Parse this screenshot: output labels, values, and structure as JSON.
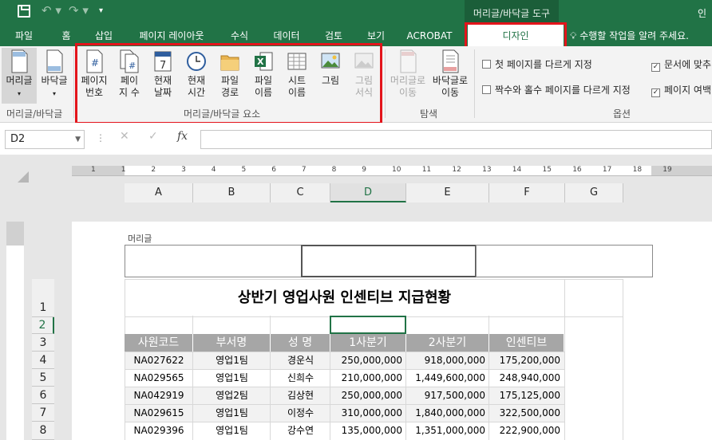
{
  "title_bar": {
    "context_group": "머리글/바닥글 도구",
    "user": "인"
  },
  "tabs": [
    "파일",
    "홈",
    "삽입",
    "페이지 레이아웃",
    "수식",
    "데이터",
    "검토",
    "보기",
    "ACROBAT",
    "디자인"
  ],
  "tell_me": "수행할 작업을 알려 주세요.",
  "ribbon": {
    "hf_group": {
      "label": "머리글/바닥글",
      "header": "머리글",
      "footer": "바닥글"
    },
    "elements_group": {
      "label": "머리글/바닥글 요소",
      "buttons": [
        {
          "l1": "페이지",
          "l2": "번호"
        },
        {
          "l1": "페이",
          "l2": "지 수"
        },
        {
          "l1": "현재",
          "l2": "날짜"
        },
        {
          "l1": "현재",
          "l2": "시간"
        },
        {
          "l1": "파일",
          "l2": "경로"
        },
        {
          "l1": "파일",
          "l2": "이름"
        },
        {
          "l1": "시트",
          "l2": "이름"
        },
        {
          "l1": "그림",
          "l2": ""
        },
        {
          "l1": "그림",
          "l2": "서식"
        }
      ]
    },
    "nav_group": {
      "label": "탐색",
      "to_header": {
        "l1": "머리글로",
        "l2": "이동"
      },
      "to_footer": {
        "l1": "바닥글로",
        "l2": "이동"
      }
    },
    "options_group": {
      "label": "옵션",
      "opt1": "첫 페이지를 다르게 지정",
      "opt2": "짝수와 홀수 페이지를 다르게 지정",
      "opt3": "문서에 맞추",
      "opt4": "페이지 여백"
    }
  },
  "formula_bar": {
    "name_box": "D2",
    "fx": "fx",
    "cancel": "✕",
    "enter": "✓",
    "value": ""
  },
  "ruler_numbers": [
    "1",
    "1",
    "2",
    "3",
    "4",
    "5",
    "6",
    "7",
    "8",
    "9",
    "10",
    "11",
    "12",
    "13",
    "14",
    "15",
    "16",
    "17",
    "18",
    "19"
  ],
  "columns": [
    "A",
    "B",
    "C",
    "D",
    "E",
    "F",
    "G"
  ],
  "rows": [
    "1",
    "2",
    "3",
    "4",
    "5",
    "6",
    "7",
    "8"
  ],
  "header_label": "머리글",
  "sheet": {
    "title": "상반기 영업사원 인센티브 지급현황",
    "headers": [
      "사원코드",
      "부서명",
      "성 명",
      "1사분기",
      "2사분기",
      "인센티브"
    ],
    "data": [
      [
        "NA027622",
        "영업1팀",
        "경운식",
        "250,000,000",
        "918,000,000",
        "175,200,000"
      ],
      [
        "NA029565",
        "영업1팀",
        "신희수",
        "210,000,000",
        "1,449,600,000",
        "248,940,000"
      ],
      [
        "NA042919",
        "영업2팀",
        "김상현",
        "250,000,000",
        "917,500,000",
        "175,125,000"
      ],
      [
        "NA029615",
        "영업1팀",
        "이정수",
        "310,000,000",
        "1,840,000,000",
        "322,500,000"
      ],
      [
        "NA029396",
        "영업1팀",
        "강수연",
        "135,000,000",
        "1,351,000,000",
        "222,900,000"
      ]
    ]
  },
  "colors": {
    "excel_green": "#217346",
    "highlight_red": "#e3141b",
    "table_header": "#a6a6a6"
  }
}
